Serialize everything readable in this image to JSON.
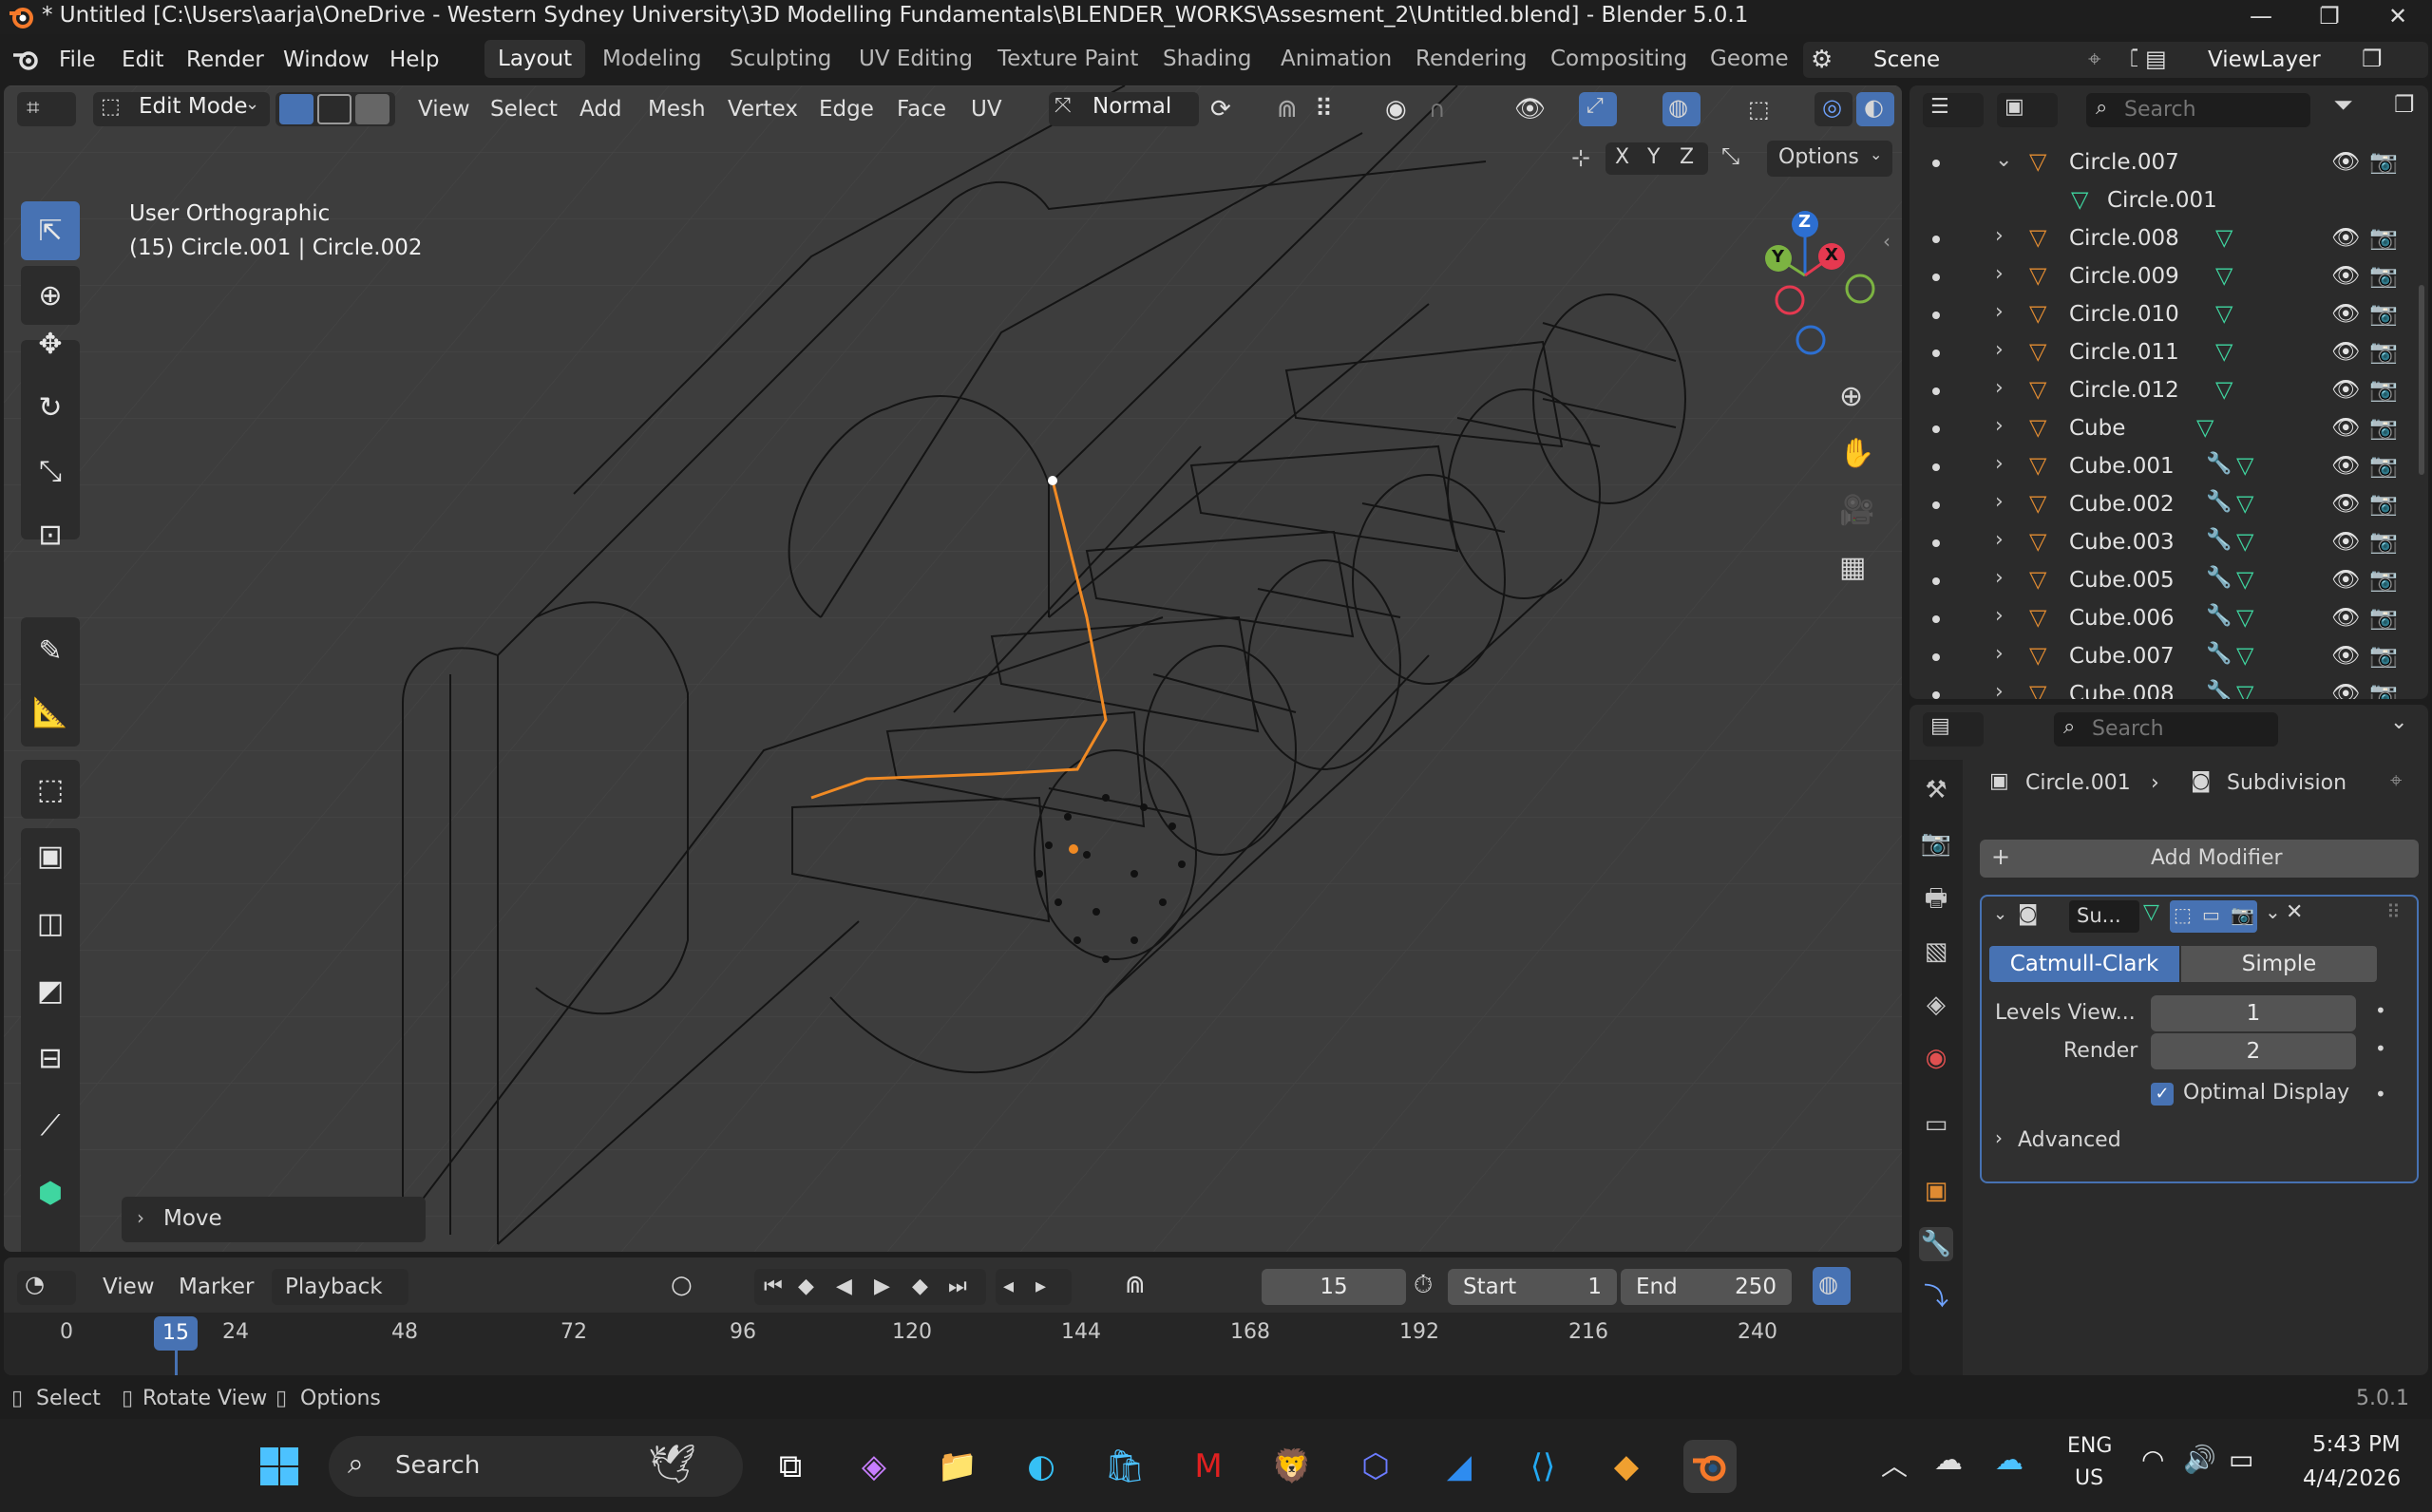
{
  "window": {
    "title": "* Untitled [C:\\Users\\aarja\\OneDrive - Western Sydney University\\3D Modelling Fundamentals\\BLENDER_WORKS\\Assesment_2\\Untitled.blend] - Blender 5.0.1",
    "minimize": "—",
    "maximize": "❐",
    "close": "✕"
  },
  "menu": {
    "file": "File",
    "edit": "Edit",
    "render": "Render",
    "window": "Window",
    "help": "Help"
  },
  "workspaces": [
    "Layout",
    "Modeling",
    "Sculpting",
    "UV Editing",
    "Texture Paint",
    "Shading",
    "Animation",
    "Rendering",
    "Compositing",
    "Geome"
  ],
  "active_workspace": "Layout",
  "scene": {
    "name": "Scene",
    "view_layer": "ViewLayer"
  },
  "viewport": {
    "mode": "Edit Mode",
    "menus": [
      "View",
      "Select",
      "Add",
      "Mesh",
      "Vertex",
      "Edge",
      "Face",
      "UV"
    ],
    "orientation": "Normal",
    "axis_x": "X",
    "axis_y": "Y",
    "axis_z": "Z",
    "options": "Options",
    "view_name": "User Orthographic",
    "object_info": "(15) Circle.001 | Circle.002",
    "last_op": "Move",
    "gizmo": {
      "x": "X",
      "y": "Y",
      "z": "Z"
    }
  },
  "timeline": {
    "menus": {
      "view": "View",
      "marker": "Marker",
      "playback": "Playback"
    },
    "current_frame": "15",
    "start_label": "Start",
    "start": "1",
    "end_label": "End",
    "end": "250",
    "ticks": [
      "0",
      "24",
      "48",
      "72",
      "96",
      "120",
      "144",
      "168",
      "192",
      "216",
      "240"
    ],
    "playhead": "15"
  },
  "statusbar": {
    "select": "Select",
    "rotate": "Rotate View",
    "options": "Options",
    "version": "5.0.1"
  },
  "outliner": {
    "search_placeholder": "Search",
    "rows": [
      {
        "name": "Circle.007",
        "expanded": true,
        "child": false
      },
      {
        "name": "Circle.001",
        "expanded": false,
        "child": true
      },
      {
        "name": "Circle.008",
        "expanded": false,
        "child": false
      },
      {
        "name": "Circle.009",
        "expanded": false,
        "child": false
      },
      {
        "name": "Circle.010",
        "expanded": false,
        "child": false
      },
      {
        "name": "Circle.011",
        "expanded": false,
        "child": false
      },
      {
        "name": "Circle.012",
        "expanded": false,
        "child": false
      },
      {
        "name": "Cube",
        "expanded": false,
        "child": false
      },
      {
        "name": "Cube.001",
        "expanded": false,
        "child": false
      },
      {
        "name": "Cube.002",
        "expanded": false,
        "child": false
      },
      {
        "name": "Cube.003",
        "expanded": false,
        "child": false
      },
      {
        "name": "Cube.005",
        "expanded": false,
        "child": false
      },
      {
        "name": "Cube.006",
        "expanded": false,
        "child": false
      },
      {
        "name": "Cube.007",
        "expanded": false,
        "child": false
      },
      {
        "name": "Cube.008",
        "expanded": false,
        "child": false
      }
    ]
  },
  "properties": {
    "search_placeholder": "Search",
    "breadcrumb_object": "Circle.001",
    "breadcrumb_modifier": "Subdivision",
    "add_modifier": "Add Modifier",
    "modifier": {
      "name": "Su...",
      "algo_catmull": "Catmull-Clark",
      "algo_simple": "Simple",
      "levels_label": "Levels View...",
      "levels": "1",
      "render_label": "Render",
      "render": "2",
      "optimal_display": "Optimal Display",
      "advanced": "Advanced"
    }
  },
  "taskbar": {
    "search": "Search",
    "lang1": "ENG",
    "lang2": "US",
    "time": "5:43 PM",
    "date": "4/4/2026"
  },
  "colors": {
    "accent": "#4772b3",
    "selected_edge": "#f08a24",
    "mesh_icon": "#e08b32",
    "data_icon": "#3fd6a0",
    "modifier_icon": "#6fa3ff"
  }
}
